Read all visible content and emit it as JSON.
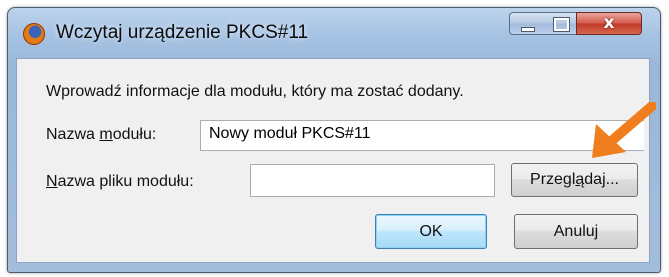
{
  "window": {
    "title": "Wczytaj urządzenie PKCS#11",
    "close_glyph": "x"
  },
  "dialog": {
    "intro": "Wprowadź informacje dla modułu, który ma zostać dodany.",
    "module_name_label_pre": "Nazwa ",
    "module_name_label_accel": "m",
    "module_name_label_post": "odułu:",
    "module_name_value": "Nowy moduł PKCS#11",
    "file_label_accel": "N",
    "file_label_post": "azwa pliku modułu:",
    "file_value": "",
    "browse_accel_pre": "Przegl",
    "browse_accel": "ą",
    "browse_post": "daj...",
    "ok_label": "OK",
    "cancel_label": "Anuluj"
  },
  "colors": {
    "annotation_arrow": "#f07d1e"
  },
  "icons": {
    "app": "firefox-icon",
    "annotation": "arrow-icon"
  }
}
